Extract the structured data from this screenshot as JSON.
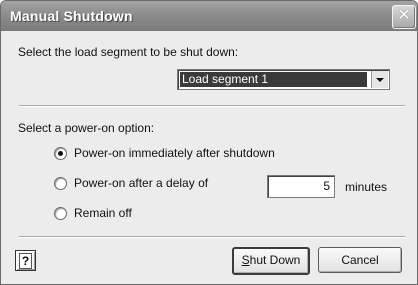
{
  "window": {
    "title": "Manual Shutdown",
    "close_icon": "close-icon"
  },
  "segment": {
    "prompt": "Select the load segment to be shut down:",
    "selected": "Load segment 1"
  },
  "power_on": {
    "prompt": "Select a power-on option:",
    "options": [
      {
        "label": "Power-on immediately after shutdown",
        "checked": true
      },
      {
        "label": "Power-on after a delay of",
        "checked": false
      },
      {
        "label": "Remain off",
        "checked": false
      }
    ],
    "delay_value": "5",
    "delay_unit": "minutes"
  },
  "buttons": {
    "help": "?",
    "shutdown_prefix": "S",
    "shutdown_rest": "hut Down",
    "cancel": "Cancel"
  }
}
